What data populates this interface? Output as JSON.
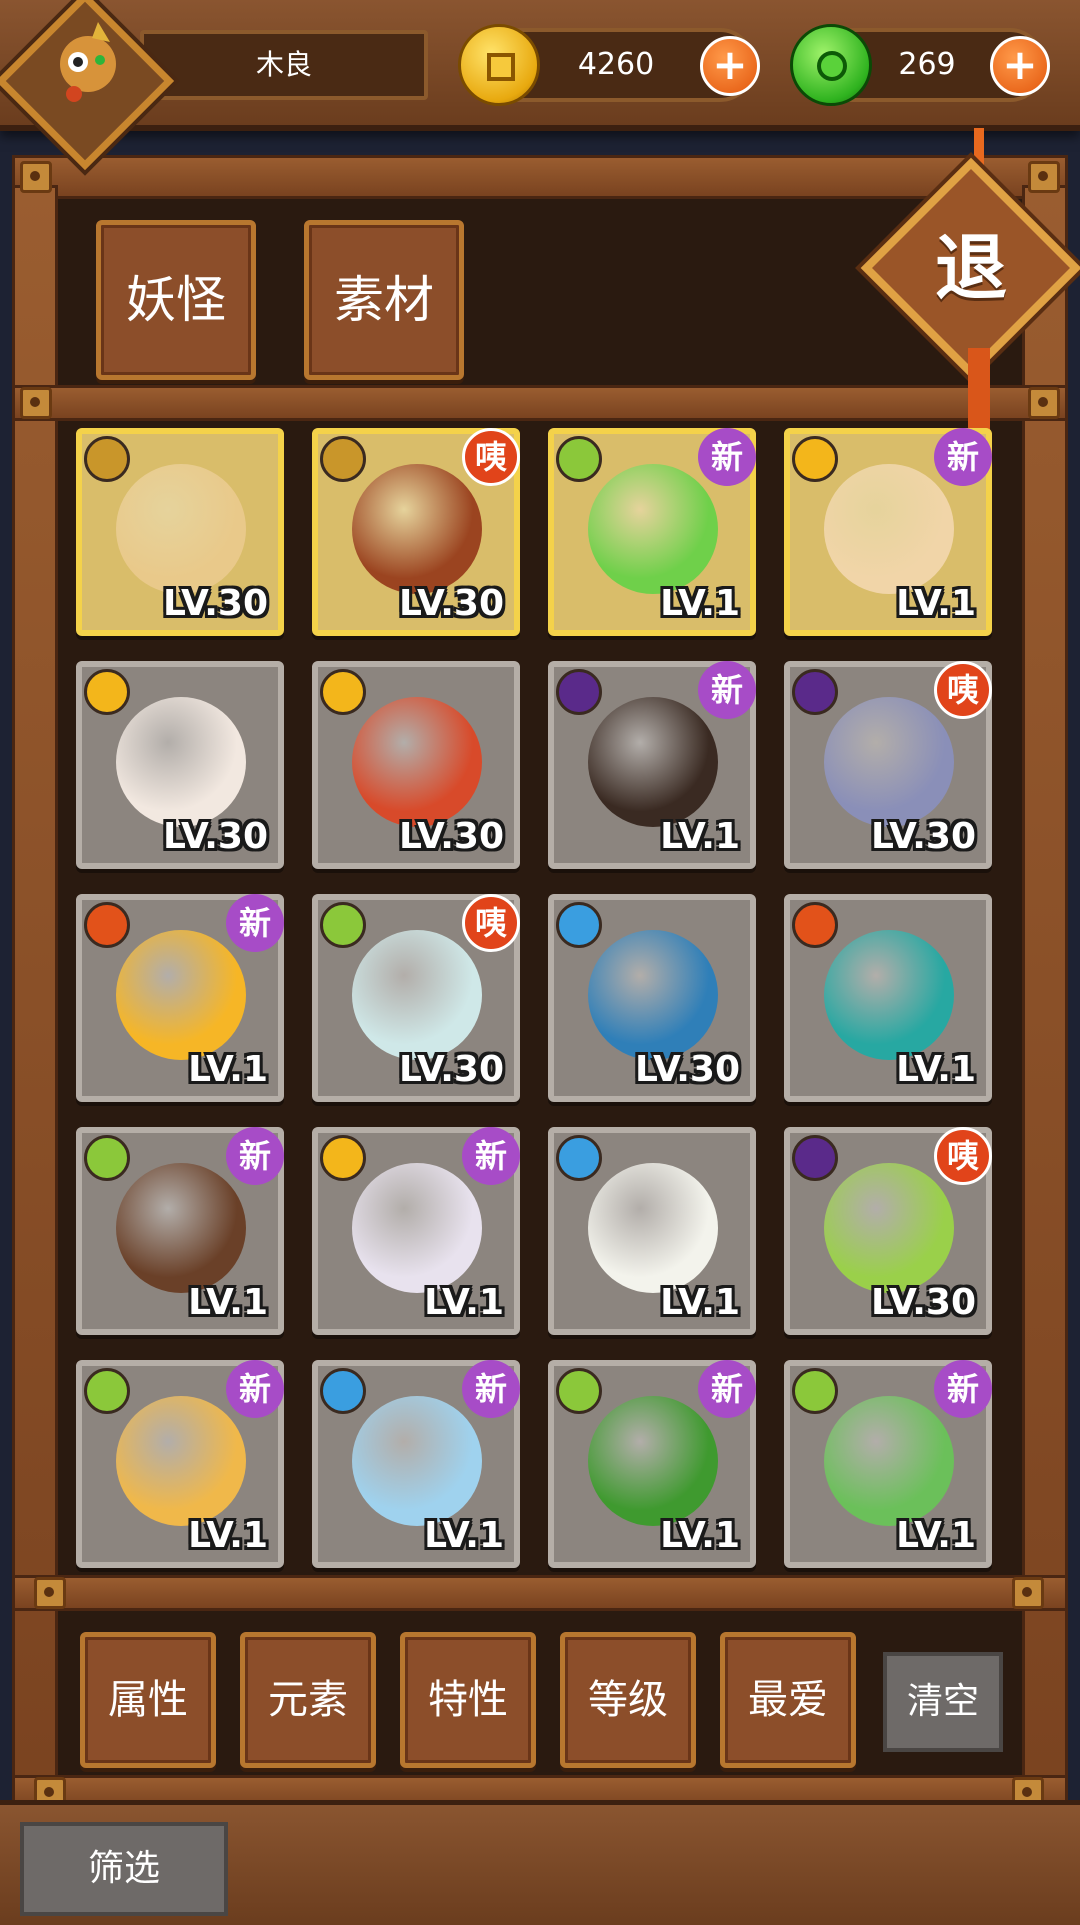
{
  "player": {
    "name": "木良"
  },
  "currency": {
    "gold": {
      "value": "4260",
      "icon": "gold-coin-icon"
    },
    "jade": {
      "value": "269",
      "icon": "green-jade-icon"
    }
  },
  "tabs": [
    {
      "label": "妖怪"
    },
    {
      "label": "素材"
    }
  ],
  "exit_label": "退",
  "filters": [
    {
      "label": "属性"
    },
    {
      "label": "元素"
    },
    {
      "label": "特性"
    },
    {
      "label": "等级"
    },
    {
      "label": "最爱"
    }
  ],
  "clear_label": "清空",
  "screen_label": "筛选",
  "colors": {
    "gold_frame": "#f4d24a",
    "new_badge": "#a74cc7",
    "red_badge": "#e1441a",
    "wood": "#8c4e2a"
  },
  "monsters": [
    {
      "element": "earth",
      "level": "LV.30",
      "badge": "",
      "frame": "gold",
      "art": "#e9c98a"
    },
    {
      "element": "earth",
      "level": "LV.30",
      "badge": "咦",
      "frame": "gold",
      "art": "#9b4420"
    },
    {
      "element": "wood",
      "level": "LV.1",
      "badge": "新",
      "frame": "gold",
      "art": "#6fd04a"
    },
    {
      "element": "light",
      "level": "LV.1",
      "badge": "新",
      "frame": "gold",
      "art": "#f1d5a8"
    },
    {
      "element": "light",
      "level": "LV.30",
      "badge": "",
      "frame": "grey",
      "art": "#f2e8e0"
    },
    {
      "element": "light",
      "level": "LV.30",
      "badge": "",
      "frame": "grey",
      "art": "#d84a2a"
    },
    {
      "element": "dark",
      "level": "LV.1",
      "badge": "新",
      "frame": "grey",
      "art": "#3a2a22"
    },
    {
      "element": "dark",
      "level": "LV.30",
      "badge": "咦",
      "frame": "grey",
      "art": "#8a8fb8"
    },
    {
      "element": "fire",
      "level": "LV.1",
      "badge": "新",
      "frame": "grey",
      "art": "#f6b626"
    },
    {
      "element": "wood",
      "level": "LV.30",
      "badge": "咦",
      "frame": "grey",
      "art": "#cfe8e8"
    },
    {
      "element": "water",
      "level": "LV.30",
      "badge": "",
      "frame": "grey",
      "art": "#2f7fb8"
    },
    {
      "element": "fire",
      "level": "LV.1",
      "badge": "",
      "frame": "grey",
      "art": "#27a8a2"
    },
    {
      "element": "wood",
      "level": "LV.1",
      "badge": "新",
      "frame": "grey",
      "art": "#6a4028"
    },
    {
      "element": "light",
      "level": "LV.1",
      "badge": "新",
      "frame": "grey",
      "art": "#e8e2ee"
    },
    {
      "element": "water",
      "level": "LV.1",
      "badge": "",
      "frame": "grey",
      "art": "#f3f3ec"
    },
    {
      "element": "dark",
      "level": "LV.30",
      "badge": "咦",
      "frame": "grey",
      "art": "#9ad04a"
    },
    {
      "element": "wood",
      "level": "LV.1",
      "badge": "新",
      "frame": "grey",
      "art": "#f0b84a"
    },
    {
      "element": "water",
      "level": "LV.1",
      "badge": "新",
      "frame": "grey",
      "art": "#9fd2ee"
    },
    {
      "element": "wood",
      "level": "LV.1",
      "badge": "新",
      "frame": "grey",
      "art": "#3f9a2f"
    },
    {
      "element": "wood",
      "level": "LV.1",
      "badge": "新",
      "frame": "grey",
      "art": "#6bc05a"
    }
  ],
  "element_colors": {
    "earth": "#c9962a",
    "wood": "#8bc83a",
    "light": "#f3b61b",
    "dark": "#5a2a8a",
    "fire": "#e2521a",
    "water": "#3a9ee0"
  }
}
